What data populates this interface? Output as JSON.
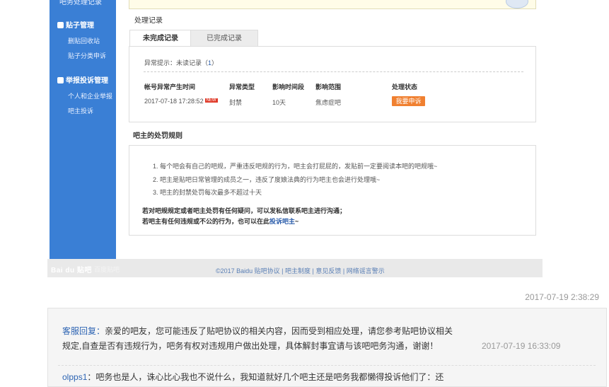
{
  "sidebar": {
    "top_item": "吧务处理记录",
    "sections": [
      {
        "title": "贴子管理",
        "items": [
          "删贴回收站",
          "贴子分类申诉"
        ]
      },
      {
        "title": "举报投诉管理",
        "items": [
          "个人和企业举报",
          "吧主投诉"
        ]
      }
    ]
  },
  "records": {
    "title": "处理记录",
    "tabs": [
      "未完成记录",
      "已完成记录"
    ],
    "hint_prefix": "异常提示：未读记录（",
    "hint_count": "1",
    "hint_suffix": "）",
    "columns": [
      "帐号异常产生时间",
      "异常类型",
      "影响时间段",
      "影响范围",
      "处理状态"
    ],
    "row": {
      "time": "2017-07-18 17:28:52",
      "badge": "NEW",
      "type": "封禁",
      "duration": "10天",
      "scope": "焦虑症吧",
      "action": "我要申诉"
    }
  },
  "rules": {
    "title": "吧主的处罚规则",
    "items": [
      "1. 每个吧会有自己的吧规，严重违反吧规的行为，吧主会打屁屁的，发贴前一定要阅读本吧的吧规哦~",
      "2. 吧主是贴吧日常管理的成员之一，违反了度娘法典的行为吧主也会进行处理哦~",
      "3. 吧主的封禁处罚每次最多不超过十天"
    ],
    "note1": "若对吧规规定或者吧主处罚有任何疑问，可以发私信联系吧主进行沟通；",
    "note2_prefix": "若吧主有任何违规或不公的行为，也可以在此",
    "note2_link": "投诉吧主",
    "note2_suffix": "~"
  },
  "footer": {
    "logo": "Bai du 贴吧",
    "logo_sub": "百度贴吧",
    "links": "©2017 Baidu 贴吧协议 | 吧主制度 | 意见反馈 | 网络谣言警示"
  },
  "post_time": "2017-07-19 2:38:29",
  "reply": {
    "author": "客服回复",
    "colon": "：",
    "text": "亲爱的吧友，您可能违反了贴吧协议的相关内容，因而受到相应处理，请您参考贴吧协议相关规定,自查是否有违规行为，吧务有权对违规用户做出处理，具体解封事宜请与该吧吧务沟通，谢谢！",
    "time": "2017-07-19 16:33:09"
  },
  "reply2": {
    "author": "olpps1",
    "colon": "：",
    "text": "吧务也是人，诛心比心我也不说什么，我知道就好几个吧主还是吧务我都懒得投诉他们了：还"
  }
}
